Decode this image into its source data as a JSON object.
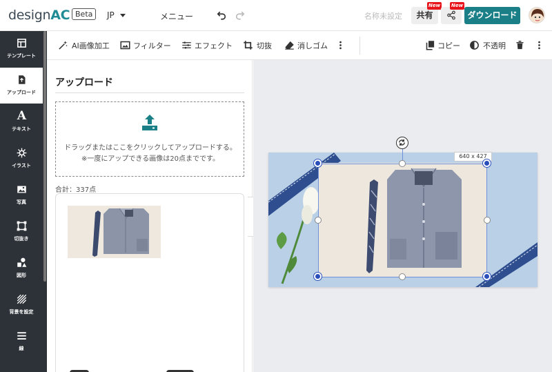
{
  "header": {
    "logo_text": "design",
    "logo_accent": "AC",
    "beta_label": "Beta",
    "language": "JP",
    "menu_label": "メニュー",
    "doc_name_placeholder": "名称未設定",
    "share_label": "共有",
    "new_badge": "New",
    "download_label": "ダウンロード",
    "accent_color": "#1a7f86"
  },
  "sidebar": {
    "items": [
      {
        "label": "テンプレート",
        "icon": "template-icon"
      },
      {
        "label": "アップロード",
        "icon": "upload-file-icon",
        "active": true
      },
      {
        "label": "テキスト",
        "icon": "text-icon"
      },
      {
        "label": "イラスト",
        "icon": "illustration-icon"
      },
      {
        "label": "写真",
        "icon": "photo-icon"
      },
      {
        "label": "切抜き",
        "icon": "crop-frame-icon"
      },
      {
        "label": "図形",
        "icon": "shapes-icon"
      },
      {
        "label": "背景を設定",
        "icon": "background-icon"
      },
      {
        "label": "線",
        "icon": "line-icon"
      }
    ]
  },
  "toolbar": {
    "ai_edit": "AI画像加工",
    "filter": "フィルター",
    "effect": "エフェクト",
    "crop": "切抜",
    "eraser": "消しゴム",
    "copy": "コピー",
    "opacity": "不透明"
  },
  "upload_panel": {
    "title": "アップロード",
    "dropzone_text": "ドラッグまたはここをクリックしてアップロードする。※一度にアップできる画像は20点までです。",
    "total_label": "合計：337点"
  },
  "canvas": {
    "selection_size": "640 x 427"
  }
}
